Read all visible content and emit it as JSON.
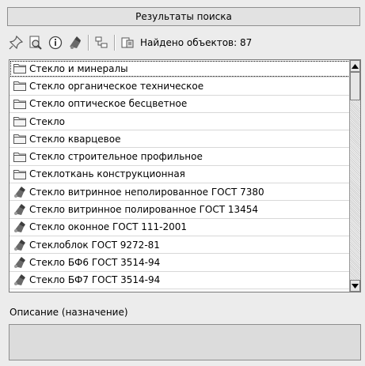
{
  "panel": {
    "title": "Результаты поиска"
  },
  "toolbar": {
    "buttons": [
      {
        "icon": "pin-add-icon"
      },
      {
        "icon": "preview-icon"
      },
      {
        "icon": "info-icon"
      },
      {
        "icon": "material-icon"
      },
      {
        "icon": "tree-icon"
      },
      {
        "icon": "export-icon"
      }
    ],
    "found_label": "Найдено объектов: 87"
  },
  "list": {
    "items": [
      {
        "label": "Стекло и минералы",
        "icon": "folder-icon"
      },
      {
        "label": "Стекло органическое техническое",
        "icon": "folder-icon"
      },
      {
        "label": "Стекло оптическое бесцветное",
        "icon": "folder-icon"
      },
      {
        "label": "Стекло",
        "icon": "folder-icon"
      },
      {
        "label": "Стекло кварцевое",
        "icon": "folder-icon"
      },
      {
        "label": "Стекло строительное профильное",
        "icon": "folder-icon"
      },
      {
        "label": "Стеклоткань конструкционная",
        "icon": "folder-icon"
      },
      {
        "label": "Стекло витринное неполированное ГОСТ 7380",
        "icon": "material-icon"
      },
      {
        "label": "Стекло витринное полированное ГОСТ 13454",
        "icon": "material-icon"
      },
      {
        "label": "Стекло оконное ГОСТ 111-2001",
        "icon": "material-icon"
      },
      {
        "label": "Стеклоблок ГОСТ 9272-81",
        "icon": "material-icon"
      },
      {
        "label": "Стекло БФ6 ГОСТ 3514-94",
        "icon": "material-icon"
      },
      {
        "label": "Стекло БФ7 ГОСТ 3514-94",
        "icon": "material-icon"
      }
    ]
  },
  "description": {
    "label": "Описание (назначение)",
    "value": ""
  }
}
